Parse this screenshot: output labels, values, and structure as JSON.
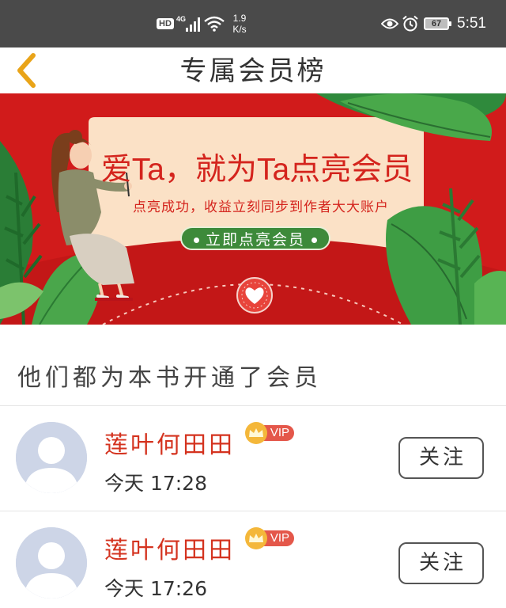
{
  "status_bar": {
    "hd": "HD",
    "network": "4G",
    "speed_value": "1.9",
    "speed_unit": "K/s",
    "battery": "67",
    "time": "5:51",
    "icons": [
      "signal-icon",
      "wifi-icon",
      "eye-icon",
      "alarm-icon",
      "battery-icon"
    ]
  },
  "nav": {
    "title": "专属会员榜",
    "back_icon": "chevron-left-icon"
  },
  "banner": {
    "headline": "爱Ta，就为Ta点亮会员",
    "subline": "点亮成功，收益立刻同步到作者大大账户",
    "cta": "立即点亮会员"
  },
  "section": {
    "title": "他们都为本书开通了会员"
  },
  "members": [
    {
      "name": "莲叶何田田",
      "badge": "VIP",
      "time": "今天  17:28",
      "follow": "关注"
    },
    {
      "name": "莲叶何田田",
      "badge": "VIP",
      "time": "今天  17:26",
      "follow": "关注"
    }
  ],
  "colors": {
    "status_bar_bg": "#4a4a4a",
    "brand_red": "#d4241d",
    "name_red": "#d4331f",
    "cta_green": "#3d8a3a",
    "vip_pill": "#e4574a",
    "crown": "#f4b73a"
  }
}
